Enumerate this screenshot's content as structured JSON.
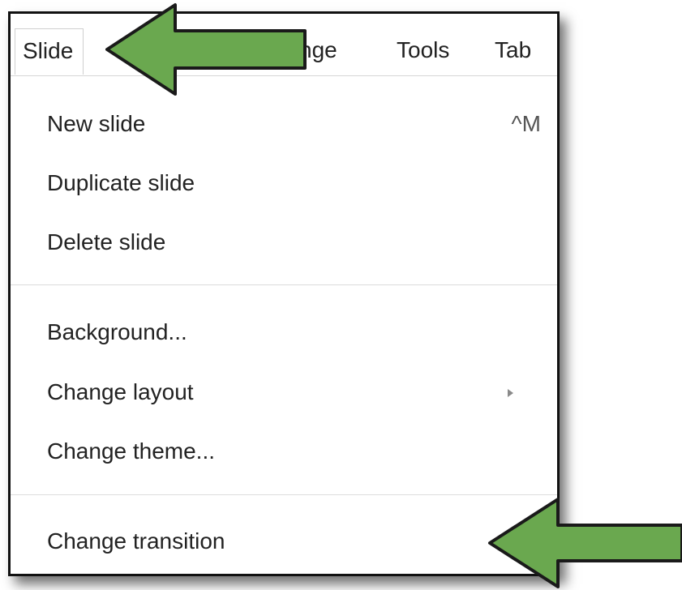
{
  "menubar": {
    "items": [
      {
        "label": "Slide",
        "active": true
      },
      {
        "label": "nge",
        "partial": true
      },
      {
        "label": "Tools"
      },
      {
        "label": "Tab",
        "partial": true
      }
    ]
  },
  "menu": {
    "groups": [
      [
        {
          "label": "New slide",
          "shortcut": "^M"
        },
        {
          "label": "Duplicate slide"
        },
        {
          "label": "Delete slide"
        }
      ],
      [
        {
          "label": "Background..."
        },
        {
          "label": "Change layout",
          "submenu": true
        },
        {
          "label": "Change theme..."
        }
      ],
      [
        {
          "label": "Change transition"
        }
      ]
    ]
  },
  "annotations": {
    "arrow_color": "#6aa84f",
    "arrow_outline": "#1a1a1a",
    "arrows": [
      {
        "points_to": "Slide",
        "direction": "left"
      },
      {
        "points_to": "Change transition",
        "direction": "left"
      }
    ]
  }
}
